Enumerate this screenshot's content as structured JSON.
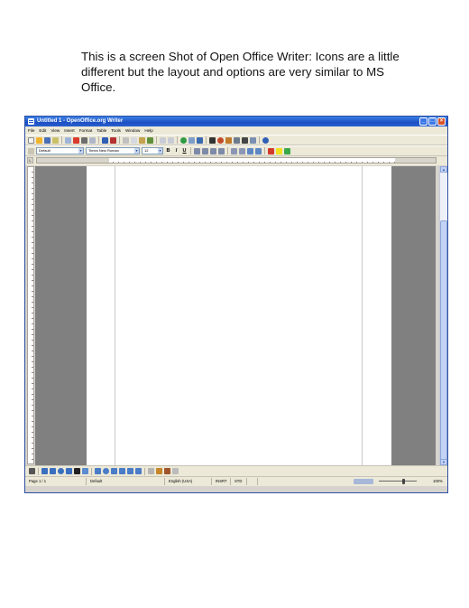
{
  "caption": "This is a screen Shot of Open Office Writer:  Icons are a little different but the layout and options are very similar to MS Office.",
  "window": {
    "title": "Untitled 1 - OpenOffice.org Writer",
    "controls": {
      "minimize": "_",
      "maximize": "□",
      "close": "×"
    }
  },
  "menu": [
    "File",
    "Edit",
    "View",
    "Insert",
    "Format",
    "Table",
    "Tools",
    "Window",
    "Help"
  ],
  "formatting": {
    "style": "Default",
    "font": "Times New Roman",
    "size": "12",
    "bold": "B",
    "italic": "I",
    "underline": "U"
  },
  "status": {
    "page": "Page 1 / 1",
    "style": "Default",
    "language": "English (USA)",
    "insert": "INSRT",
    "selection": "STD",
    "zoom": "100%"
  },
  "icons": {
    "toolbar1": [
      "new-document-icon",
      "open-icon",
      "save-icon",
      "email-icon",
      "edit-file-icon",
      "export-pdf-icon",
      "print-icon",
      "page-preview-icon",
      "spellcheck-icon",
      "autospellcheck-icon",
      "cut-icon",
      "copy-icon",
      "paste-icon",
      "format-paintbrush-icon",
      "undo-icon",
      "redo-icon",
      "hyperlink-icon",
      "table-icon",
      "show-draw-icon",
      "find-replace-icon",
      "navigator-icon",
      "gallery-icon",
      "data-sources-icon",
      "nonprinting-chars-icon",
      "zoom-icon",
      "help-icon"
    ],
    "toolbar2_trailing": [
      "align-left-icon",
      "align-center-icon",
      "align-right-icon",
      "justify-icon",
      "numbering-icon",
      "bullets-icon",
      "decrease-indent-icon",
      "increase-indent-icon",
      "font-color-icon",
      "highlight-icon",
      "background-color-icon"
    ],
    "draw": [
      "select-icon",
      "line-icon",
      "rectangle-icon",
      "ellipse-icon",
      "freeform-icon",
      "text-icon",
      "callout-icon",
      "basic-shapes-icon",
      "symbol-shapes-icon",
      "block-arrows-icon",
      "flowchart-icon",
      "callouts-icon",
      "stars-icon",
      "points-icon",
      "fontwork-icon",
      "from-file-icon",
      "extrusion-icon"
    ]
  }
}
